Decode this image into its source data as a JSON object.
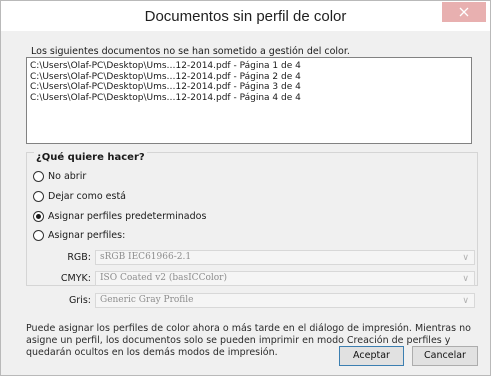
{
  "window": {
    "title": "Documentos sin perfil de color"
  },
  "intro": "Los siguientes documentos no se han sometido a gestión del color.",
  "documents": [
    "C:\\Users\\Olaf-PC\\Desktop\\Ums…12-2014.pdf - Página 1 de 4",
    "C:\\Users\\Olaf-PC\\Desktop\\Ums…12-2014.pdf - Página 2 de 4",
    "C:\\Users\\Olaf-PC\\Desktop\\Ums…12-2014.pdf - Página 3 de 4",
    "C:\\Users\\Olaf-PC\\Desktop\\Ums…12-2014.pdf - Página 4 de 4"
  ],
  "options": {
    "heading": "¿Qué quiere hacer?",
    "items": [
      {
        "label": "No abrir",
        "selected": false
      },
      {
        "label": "Dejar como está",
        "selected": false
      },
      {
        "label": "Asignar perfiles predeterminados",
        "selected": true
      },
      {
        "label": "Asignar perfiles:",
        "selected": false
      }
    ],
    "profiles": [
      {
        "label": "RGB:",
        "value": "sRGB IEC61966-2.1"
      },
      {
        "label": "CMYK:",
        "value": "ISO Coated v2 (basICColor)"
      },
      {
        "label": "Gris:",
        "value": "Generic Gray Profile"
      }
    ]
  },
  "note": "Puede asignar los perfiles de color ahora o más tarde en el diálogo de impresión. Mientras no asigne un perfil, los documentos solo se pueden imprimir en modo Creación de perfiles y quedarán ocultos en los demás modos de impresión.",
  "buttons": {
    "accept": "Aceptar",
    "cancel": "Cancelar"
  },
  "icons": {
    "close": "close-icon",
    "dropdown": "chevron-down-icon"
  },
  "colors": {
    "close_bg": "#e8b0b0",
    "primary_border": "#3c7fb1"
  }
}
